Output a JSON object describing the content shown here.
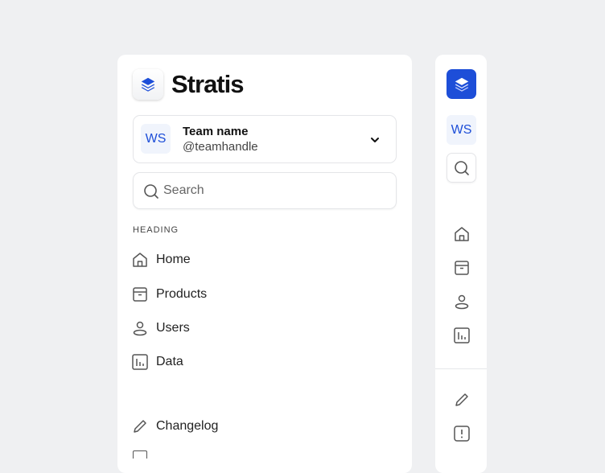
{
  "brand": {
    "name": "Stratis",
    "accent": "#1d4ed8"
  },
  "team": {
    "initials": "WS",
    "name": "Team name",
    "handle": "@teamhandle"
  },
  "search": {
    "placeholder": "Search"
  },
  "nav": {
    "heading": "HEADING",
    "items": [
      {
        "label": "Home",
        "icon": "home-icon"
      },
      {
        "label": "Products",
        "icon": "archive-icon"
      },
      {
        "label": "Users",
        "icon": "user-icon"
      },
      {
        "label": "Data",
        "icon": "chart-icon"
      }
    ],
    "footer": [
      {
        "label": "Changelog",
        "icon": "pencil-icon"
      }
    ]
  },
  "collapsed": {
    "initials": "WS"
  }
}
